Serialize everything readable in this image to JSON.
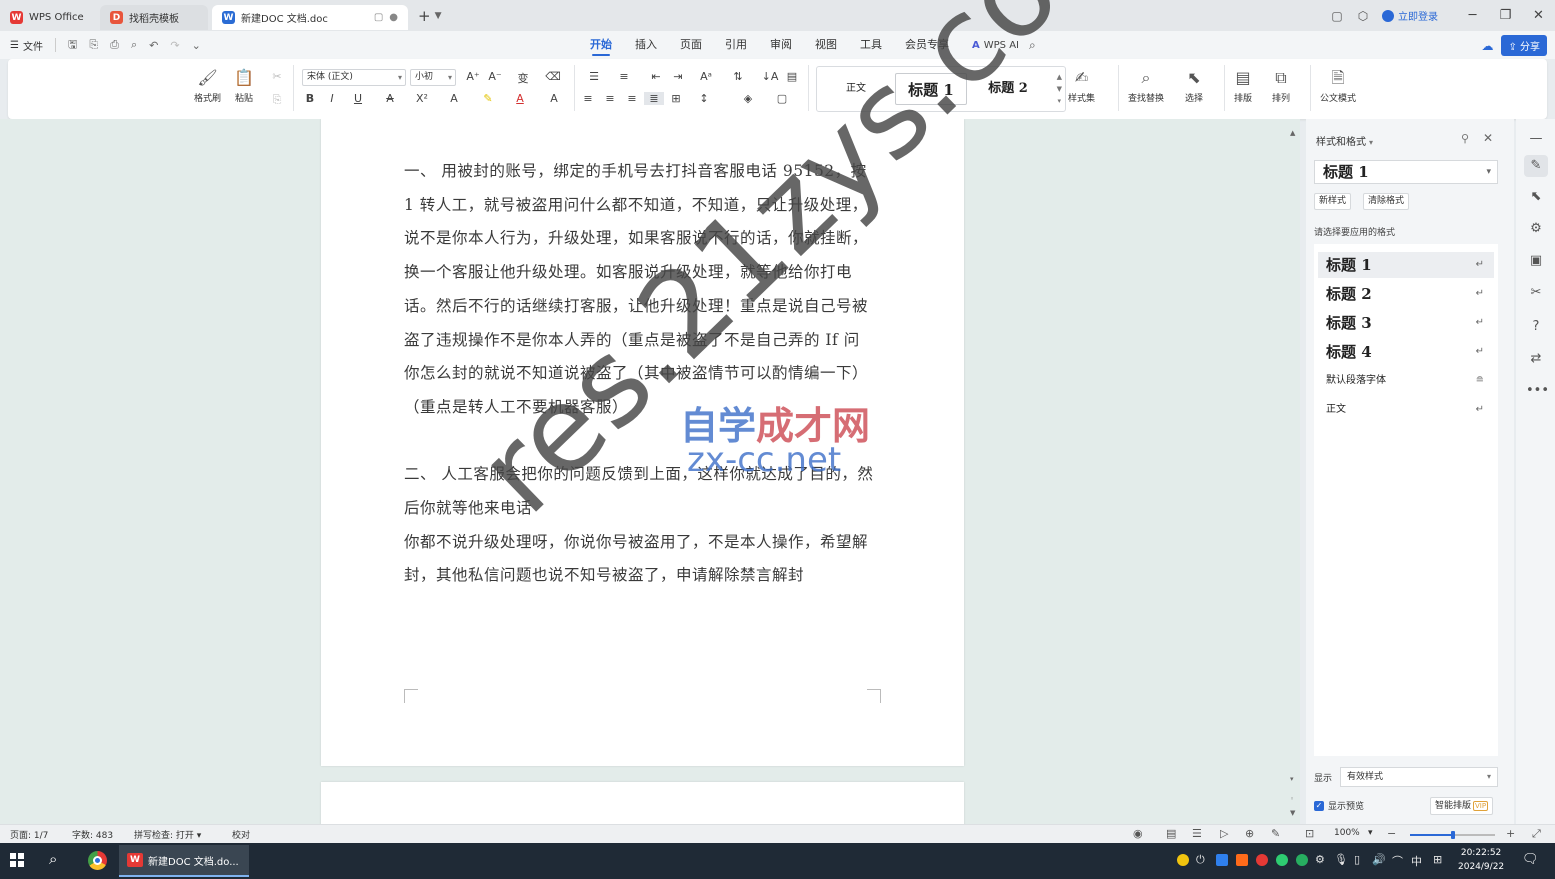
{
  "titlebar": {
    "tabs": [
      {
        "label": "WPS Office",
        "icon": "wps-logo-icon"
      },
      {
        "label": "找稻壳模板",
        "icon": "template-icon"
      },
      {
        "label": "新建DOC 文档.doc",
        "icon": "word-doc-icon"
      }
    ],
    "login_label": "立即登录"
  },
  "menu": {
    "file_label": "文件",
    "tabs": [
      "开始",
      "插入",
      "页面",
      "引用",
      "审阅",
      "视图",
      "工具",
      "会员专享"
    ],
    "active_tab": "开始",
    "wps_ai_label": "WPS AI",
    "share_label": "分享"
  },
  "ribbon": {
    "format_painter": "格式刷",
    "paste": "粘贴",
    "font_name": "宋体 (正文)",
    "font_size": "小初",
    "styles": {
      "normal": "正文",
      "heading1": "标题 1",
      "heading2": "标题 2"
    },
    "style_set": "样式集",
    "find_replace": "查找替换",
    "select": "选择",
    "layout": "排版",
    "arrange": "排列",
    "official_mode": "公文模式"
  },
  "document": {
    "paragraphs": [
      "一、 用被封的账号，绑定的手机号去打抖音客服电话 95152，按 1 转人工，就号被盗用问什么都不知道，不知道，只让升级处理，说不是你本人行为，升级处理，如果客服说不行的话，你就挂断，换一个客服让他升级处理。如客服说升级处理，就等他给你打电话。然后不行的话继续打客服，让他升级处理！重点是说自己号被盗了违规操作不是你本人弄的（重点是被盗了不是自己弄的 If 问你怎么封的就说不知道说被盗了（其中被盗情节可以酌情编一下）",
      "（重点是转人工不要机器客服）",
      "",
      "二、 人工客服会把你的问题反馈到上面，这样你就达成了目的，然后你就等他来电话",
      "你都不说升级处理呀，你说你号被盗用了，不是本人操作，希望解封，其他私信问题也说不知号被盗了，申请解除禁言解封"
    ]
  },
  "watermark": {
    "main": "res.21zys.com",
    "cn_part1": "自学",
    "cn_part2": "成才网",
    "url": "zx-cc.net"
  },
  "pane": {
    "title": "样式和格式",
    "current_style": "标题 1",
    "new_style_btn": "新样式",
    "clear_format_btn": "清除格式",
    "prompt": "请选择要应用的格式",
    "styles": [
      {
        "label": "标题 1",
        "kind": "heading"
      },
      {
        "label": "标题 2",
        "kind": "heading"
      },
      {
        "label": "标题 3",
        "kind": "heading"
      },
      {
        "label": "标题 4",
        "kind": "heading"
      },
      {
        "label": "默认段落字体",
        "kind": "normal"
      },
      {
        "label": "正文",
        "kind": "normal"
      }
    ],
    "show_label": "显示",
    "show_value": "有效样式",
    "preview_label": "显示预览",
    "smart_layout": "智能排版",
    "vip_badge": "VIP"
  },
  "status": {
    "page": "页面: 1/7",
    "words": "字数: 483",
    "spellcheck": "拼写检查: 打开",
    "proofread": "校对",
    "zoom": "100%",
    "zoom_fraction": 0.5
  },
  "taskbar": {
    "app_label": "新建DOC 文档.do...",
    "ime": "中",
    "time": "20:22:52",
    "date": "2024/9/22"
  }
}
